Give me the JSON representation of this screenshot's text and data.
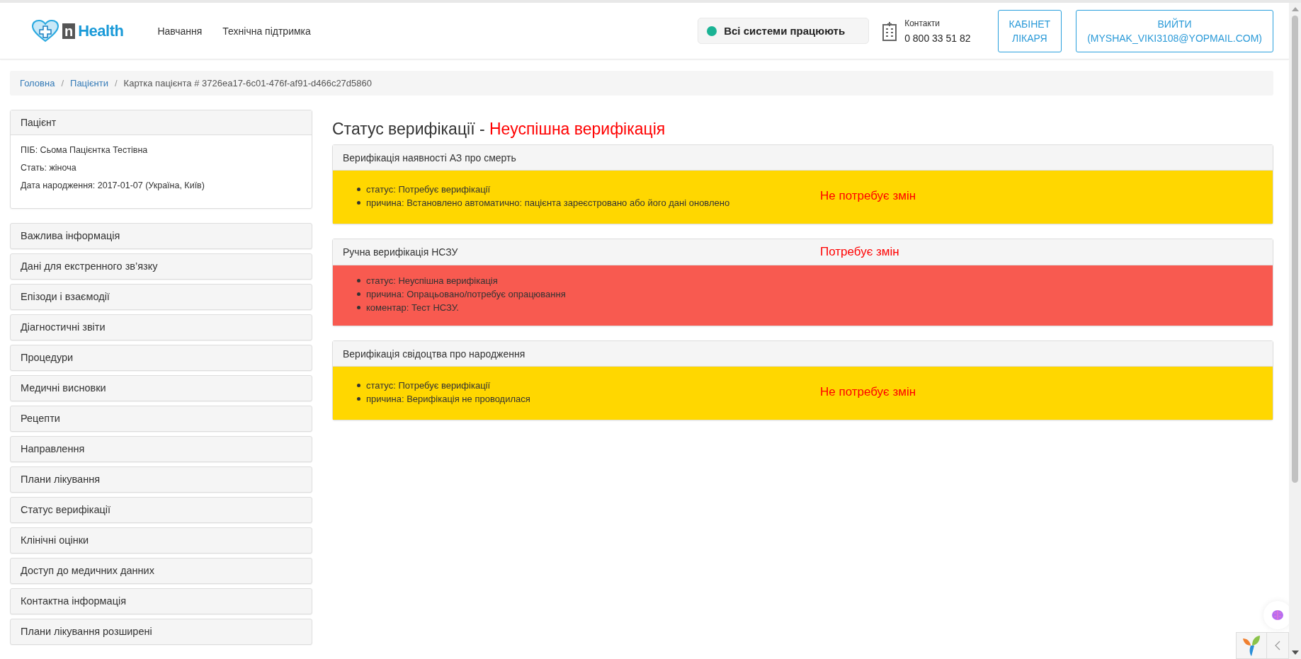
{
  "header": {
    "logo": "Health",
    "logo_mark": "n",
    "nav": [
      "Навчання",
      "Технічна підтримка"
    ],
    "system_status": {
      "label": "Всі системи працюють",
      "color": "#1ab394"
    },
    "contacts": {
      "label": "Контакти",
      "phone": "0 800 33 51 82"
    },
    "buttons": [
      [
        "КАБІНЕТ",
        "ЛІКАРЯ"
      ],
      [
        "ВИЙТИ",
        "(MYSHAK_VIKI3108@YOPMAIL.COM)"
      ]
    ]
  },
  "breadcrumb_separator": "/",
  "breadcrumb": [
    {
      "label": "Головна",
      "link": true
    },
    {
      "label": "Пацієнти",
      "link": true
    },
    {
      "label": "Картка пацієнта # 3726ea17-6c01-476f-af91-d466c27d5860",
      "link": false
    }
  ],
  "patient": {
    "title": "Пацієнт",
    "fields": [
      "ПІБ: Сьома Пацієнтка Тестівна",
      "Стать: жіноча",
      "Дата народження: 2017-01-07 (Україна, Київ)"
    ]
  },
  "menu": [
    "Важлива інформація",
    "Дані для екстренного зв’язку",
    "Епізоди і взаємодії",
    "Діагностичні звіти",
    "Процедури",
    "Медичні висновки",
    "Рецепти",
    "Направлення",
    "Плани лікування",
    "Статус верифікації",
    "Клінічні оцінки",
    "Доступ до медичних данних",
    "Контактна інформація",
    "Плани лікування розширені"
  ],
  "title": {
    "label": "Статус верифікації - ",
    "value": "Неуспішна верифікація"
  },
  "panels": [
    {
      "title": "Верифікація наявності АЗ про смерть",
      "kind": "warning",
      "items": [
        "статус: Потребує верифікації",
        "причина: Встановлено автоматично: пацієнта зареєстровано або його дані оновлено"
      ],
      "note": "Не потребує змін",
      "note_in_header": false
    },
    {
      "title": "Ручна верифікація НСЗУ",
      "kind": "danger",
      "items": [
        "статус: Неуспішна верифікація",
        "причина: Опрацьовано/потребує опрацювання",
        "коментар: Тест НСЗУ."
      ],
      "note": "Потребує змін",
      "note_in_header": true
    },
    {
      "title": "Верифікація свідоцтва про народження",
      "kind": "warning",
      "items": [
        "статус: Потребує верифікації",
        "причина: Верифікація не проводилася"
      ],
      "note": "Не потребує змін",
      "note_in_header": false
    }
  ]
}
